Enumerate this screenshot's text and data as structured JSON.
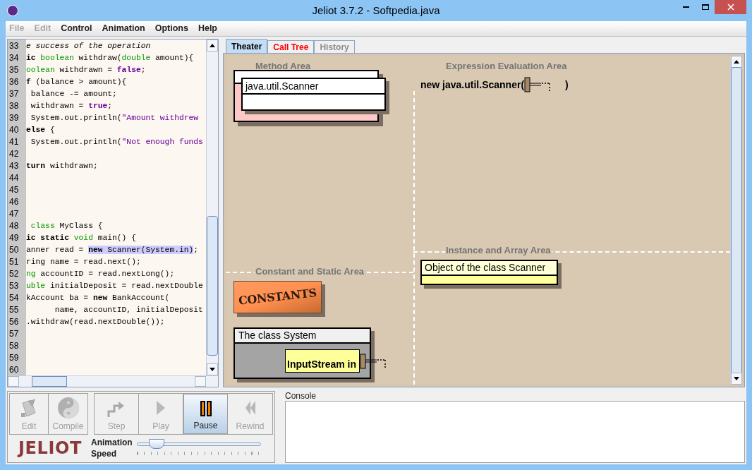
{
  "window": {
    "title": "Jeliot 3.7.2 - Softpedia.java"
  },
  "menu": [
    {
      "label": "File",
      "disabled": true
    },
    {
      "label": "Edit",
      "disabled": true
    },
    {
      "label": "Control",
      "disabled": false
    },
    {
      "label": "Animation",
      "disabled": false
    },
    {
      "label": "Options",
      "disabled": false
    },
    {
      "label": "Help",
      "disabled": false
    }
  ],
  "editor": {
    "lines": [
      {
        "number": "33",
        "segments": [
          {
            "kind": "comment",
            "text": "e success of the operation"
          }
        ]
      },
      {
        "number": "34",
        "segments": [
          {
            "kind": "keyword",
            "text": "ic"
          },
          {
            "kind": "type",
            "text": " boolean"
          },
          {
            "kind": "plain",
            "text": " withdraw("
          },
          {
            "kind": "type",
            "text": "double"
          },
          {
            "kind": "plain",
            "text": " amount){"
          }
        ]
      },
      {
        "number": "35",
        "segments": [
          {
            "kind": "type",
            "text": "oolean"
          },
          {
            "kind": "plain",
            "text": " withdrawn = "
          },
          {
            "kind": "literal",
            "text": "false"
          },
          {
            "kind": "plain",
            "text": ";"
          }
        ]
      },
      {
        "number": "36",
        "segments": [
          {
            "kind": "keyword",
            "text": "f"
          },
          {
            "kind": "plain",
            "text": " (balance > amount){"
          }
        ]
      },
      {
        "number": "37",
        "segments": [
          {
            "kind": "plain",
            "text": " balance -= amount;"
          }
        ]
      },
      {
        "number": "38",
        "segments": [
          {
            "kind": "plain",
            "text": " withdrawn = "
          },
          {
            "kind": "literal",
            "text": "true"
          },
          {
            "kind": "plain",
            "text": ";"
          }
        ]
      },
      {
        "number": "39",
        "segments": [
          {
            "kind": "plain",
            "text": " System.out.println("
          },
          {
            "kind": "string",
            "text": "\"Amount withdrew"
          }
        ]
      },
      {
        "number": "40",
        "segments": [
          {
            "kind": "keyword",
            "text": "else"
          },
          {
            "kind": "plain",
            "text": " {"
          }
        ]
      },
      {
        "number": "41",
        "segments": [
          {
            "kind": "plain",
            "text": " System.out.println("
          },
          {
            "kind": "string",
            "text": "\"Not enough funds"
          }
        ]
      },
      {
        "number": "42"
      },
      {
        "number": "43",
        "segments": [
          {
            "kind": "keyword",
            "text": "turn"
          },
          {
            "kind": "plain",
            "text": " withdrawn;"
          }
        ]
      },
      {
        "number": "44"
      },
      {
        "number": "45"
      },
      {
        "number": "46"
      },
      {
        "number": "47"
      },
      {
        "number": "48",
        "segments": [
          {
            "kind": "type",
            "text": " class"
          },
          {
            "kind": "plain",
            "text": " MyClass {"
          }
        ]
      },
      {
        "number": "49",
        "segments": [
          {
            "kind": "keyword",
            "text": "ic static"
          },
          {
            "kind": "type",
            "text": " void"
          },
          {
            "kind": "plain",
            "text": " main() {"
          }
        ]
      },
      {
        "number": "50",
        "segments": [
          {
            "kind": "plain",
            "text": "anner read = "
          },
          {
            "kind": "keyword_highlighted",
            "text": "new"
          },
          {
            "kind": "plain_highlighted",
            "text": " Scanner(System.in)"
          },
          {
            "kind": "plain",
            "text": ";"
          }
        ]
      },
      {
        "number": "51",
        "segments": [
          {
            "kind": "plain",
            "text": "ring name = read.next();"
          }
        ]
      },
      {
        "number": "52",
        "segments": [
          {
            "kind": "type",
            "text": "ng"
          },
          {
            "kind": "plain",
            "text": " accountID = read.nextLong();"
          }
        ]
      },
      {
        "number": "53",
        "segments": [
          {
            "kind": "type",
            "text": "uble"
          },
          {
            "kind": "plain",
            "text": " initialDeposit = read.nextDouble"
          }
        ]
      },
      {
        "number": "54",
        "segments": [
          {
            "kind": "plain",
            "text": "kAccount ba = "
          },
          {
            "kind": "keyword",
            "text": "new"
          },
          {
            "kind": "plain",
            "text": " BankAccount("
          }
        ]
      },
      {
        "number": "55",
        "segments": [
          {
            "kind": "plain",
            "text": "      name, accountID, initialDeposit"
          }
        ]
      },
      {
        "number": "56",
        "segments": [
          {
            "kind": "plain",
            "text": ".withdraw(read.nextDouble());"
          }
        ]
      },
      {
        "number": "57"
      },
      {
        "number": "58"
      },
      {
        "number": "59"
      },
      {
        "number": "60"
      }
    ]
  },
  "tabs": [
    {
      "label": "Theater",
      "selected": true,
      "color": "#000000"
    },
    {
      "label": "Call Tree",
      "selected": false,
      "color": "#ff0000"
    },
    {
      "label": "History",
      "selected": false,
      "color": "#8c8c8c"
    }
  ],
  "theater": {
    "areas": [
      "Method Area",
      "Expression Evaluation Area",
      "Instance and Array Area",
      "Constant and Static Area"
    ],
    "scanner_frame": {
      "title": "java.util.Scanner"
    },
    "expression": {
      "before": "new java.util.Scanner(",
      "after": ")"
    },
    "object": {
      "title": "Object of the class Scanner"
    },
    "constants": {
      "label": "CONSTANTS"
    },
    "static_class": {
      "title": "The class System",
      "field": "InputStream in"
    }
  },
  "controls": {
    "buttons": [
      {
        "label": "Edit",
        "kind": "edit",
        "disabled": true,
        "pressed": false
      },
      {
        "label": "Compile",
        "kind": "compile",
        "disabled": true,
        "pressed": false
      },
      {
        "label": "Step",
        "kind": "step",
        "disabled": true,
        "pressed": false
      },
      {
        "label": "Play",
        "kind": "play",
        "disabled": true,
        "pressed": false
      },
      {
        "label": "Pause",
        "kind": "pause",
        "disabled": false,
        "pressed": true
      },
      {
        "label": "Rewind",
        "kind": "rewind",
        "disabled": true,
        "pressed": false
      }
    ],
    "logo": "JELIOT",
    "speed": {
      "label_1": "Animation",
      "label_2": "Speed",
      "level": 0.1
    }
  },
  "console": {
    "label": "Console"
  }
}
